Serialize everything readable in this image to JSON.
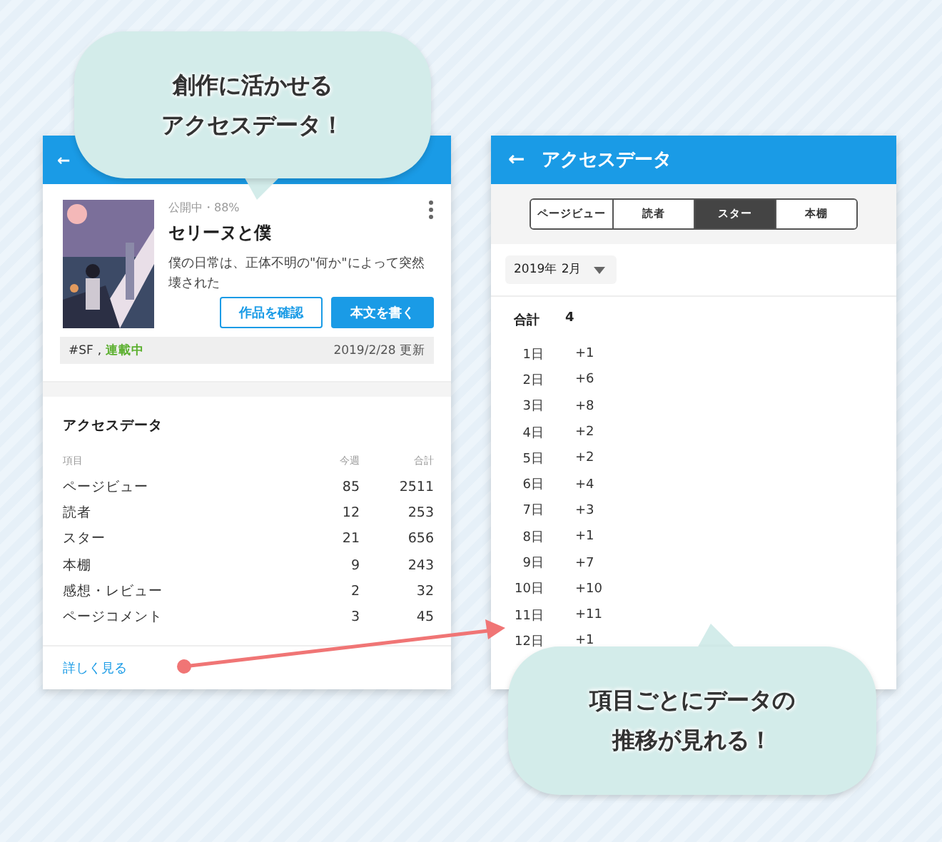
{
  "callouts": [
    {
      "lines": [
        "創作に活かせる",
        "アクセスデータ！"
      ]
    },
    {
      "lines": [
        "項目ごとにデータの",
        "推移が見れる！"
      ]
    }
  ],
  "work_screen": {
    "back": "←",
    "work": {
      "status": "公開中・88%",
      "title": "セリーヌと僕",
      "description": "僕の日常は、正体不明の\"何か\"によって突然壊された",
      "buttons": [
        {
          "label": "作品を確認",
          "kind": "outline"
        },
        {
          "label": "本文を書く",
          "kind": "primary"
        }
      ],
      "tags": [
        {
          "text": "#SF",
          "kind": "plain"
        },
        {
          "text": ",",
          "kind": "plain"
        },
        {
          "text": "連載中",
          "kind": "status"
        }
      ],
      "updated": "2019/2/28 更新"
    },
    "access": {
      "title": "アクセスデータ",
      "columns": [
        "項目",
        "今週",
        "合計"
      ],
      "rows": [
        [
          "ページビュー",
          "85",
          "2511"
        ],
        [
          "読者",
          "12",
          "253"
        ],
        [
          "スター",
          "21",
          "656"
        ],
        [
          "本棚",
          "9",
          "243"
        ],
        [
          "感想・レビュー",
          "2",
          "32"
        ],
        [
          "ページコメント",
          "3",
          "45"
        ]
      ],
      "more_link": "詳しく見る"
    }
  },
  "detail_screen": {
    "back": "←",
    "title": "アクセスデータ",
    "tabs": [
      {
        "label": "ページビュー",
        "selected": false
      },
      {
        "label": "読者",
        "selected": false
      },
      {
        "label": "スター",
        "selected": true
      },
      {
        "label": "本棚",
        "selected": false
      }
    ],
    "month": "2019年 2月",
    "total_label": "合計",
    "total": "4",
    "days": [
      [
        "1日",
        "+1"
      ],
      [
        "2日",
        "+6"
      ],
      [
        "3日",
        "+8"
      ],
      [
        "4日",
        "+2"
      ],
      [
        "5日",
        "+2"
      ],
      [
        "6日",
        "+4"
      ],
      [
        "7日",
        "+3"
      ],
      [
        "8日",
        "+1"
      ],
      [
        "9日",
        "+7"
      ],
      [
        "10日",
        "+10"
      ],
      [
        "11日",
        "+11"
      ],
      [
        "12日",
        "+1"
      ]
    ]
  }
}
